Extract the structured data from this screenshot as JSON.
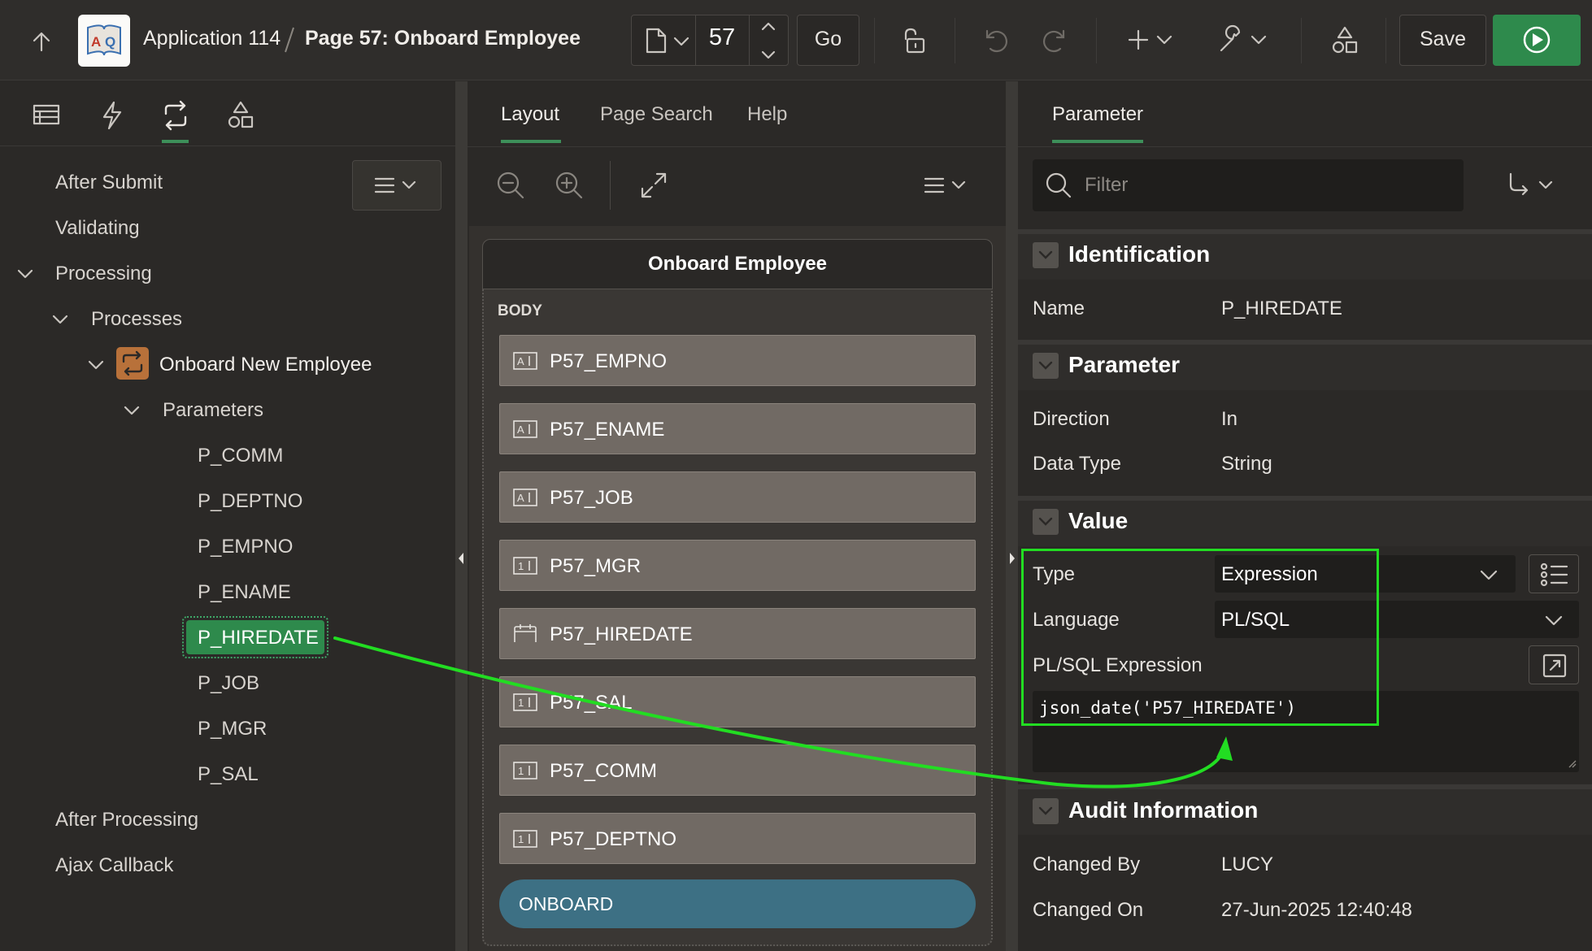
{
  "header": {
    "app_title": "Application 114",
    "page_title": "Page 57: Onboard Employee",
    "page_number": "57",
    "go_label": "Go",
    "save_label": "Save",
    "icons": [
      "up-arrow-icon",
      "app-logo-icon",
      "page-icon",
      "lock-icon",
      "undo-icon",
      "redo-icon",
      "plus-icon",
      "wrench-icon",
      "shared-components-icon",
      "run-icon"
    ]
  },
  "left_panel": {
    "tabs": [
      "rendering-tab",
      "dynamic-actions-tab",
      "processing-tab",
      "shared-components-tab"
    ],
    "active_tab": "processing",
    "tree": {
      "after_submit": "After Submit",
      "validating": "Validating",
      "processing": "Processing",
      "processes": "Processes",
      "process_name": "Onboard New Employee",
      "parameters": "Parameters",
      "params": [
        "P_COMM",
        "P_DEPTNO",
        "P_EMPNO",
        "P_ENAME",
        "P_HIREDATE",
        "P_JOB",
        "P_MGR",
        "P_SAL"
      ],
      "selected_param": "P_HIREDATE",
      "after_processing": "After Processing",
      "ajax_callback": "Ajax Callback"
    }
  },
  "middle_panel": {
    "tabs": [
      "Layout",
      "Page Search",
      "Help"
    ],
    "active_tab": "Layout",
    "region_title": "Onboard Employee",
    "body_label": "BODY",
    "items": [
      {
        "label": "P57_EMPNO",
        "icon": "text-field-icon"
      },
      {
        "label": "P57_ENAME",
        "icon": "text-field-icon"
      },
      {
        "label": "P57_JOB",
        "icon": "text-field-icon"
      },
      {
        "label": "P57_MGR",
        "icon": "number-field-icon"
      },
      {
        "label": "P57_HIREDATE",
        "icon": "date-picker-icon"
      },
      {
        "label": "P57_SAL",
        "icon": "number-field-icon"
      },
      {
        "label": "P57_COMM",
        "icon": "number-field-icon"
      },
      {
        "label": "P57_DEPTNO",
        "icon": "number-field-icon"
      }
    ],
    "button_label": "ONBOARD"
  },
  "right_panel": {
    "tab": "Parameter",
    "filter_placeholder": "Filter",
    "identification": {
      "title": "Identification",
      "name_label": "Name",
      "name_value": "P_HIREDATE"
    },
    "parameter": {
      "title": "Parameter",
      "direction_label": "Direction",
      "direction_value": "In",
      "datatype_label": "Data Type",
      "datatype_value": "String"
    },
    "value": {
      "title": "Value",
      "type_label": "Type",
      "type_value": "Expression",
      "language_label": "Language",
      "language_value": "PL/SQL",
      "expression_label": "PL/SQL Expression",
      "expression_value": "json_date('P57_HIREDATE')"
    },
    "audit": {
      "title": "Audit Information",
      "changed_by_label": "Changed By",
      "changed_by_value": "LUCY",
      "changed_on_label": "Changed On",
      "changed_on_value": "27-Jun-2025 12:40:48"
    }
  },
  "colors": {
    "accent_green": "#2e8a4c",
    "highlight_green": "#22dd22",
    "button_blue": "#3d7084",
    "item_gray": "#716a64"
  }
}
